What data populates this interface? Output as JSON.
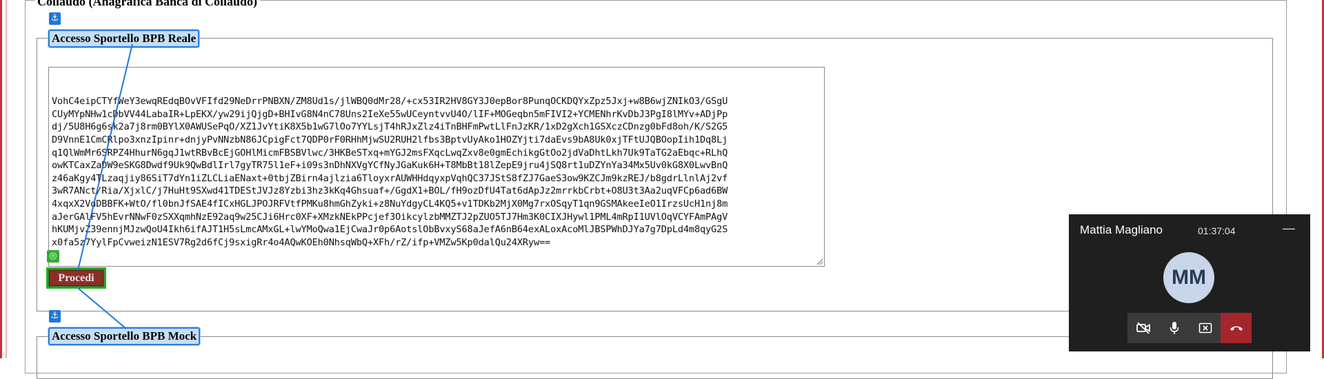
{
  "page": {
    "outer_legend": "Collaudo (Anagrafica Banca di Collaudo)",
    "section_real": {
      "legend": "Accesso Sportello BPB Reale"
    },
    "section_mock": {
      "legend": "Accesso Sportello BPB Mock"
    }
  },
  "token_lines": [
    "VohC4eipCTYfWeY3ewqREdqBOvVFIfd29NeDrrPNBXN/ZM8Ud1s/jlWBQ0dMr28/+cx53IR2HV8GY3J0epBor8PunqOCKDQYxZpz5Jxj+w8B6wjZNIkO3/GSgU",
    "CUyMYpNHw1cDbVV44LabaIR+LpEKX/yw29ijQjgD+BHIvG8N4nC78Uns2IeXe55wUCeyntvvU4O/lIF+MOGeqbn5mFIVI2+YCMENhrKvDbJ3PgI8lMYv+ADjPp",
    "dj/5U8H6g6sk2a7j8rm0BYlX0AWUSePqO/XZ1JvYtiK8X5b1wG7lOo7YYLsjT4hRJxZlz4iTnBHFmPwtLlFnJzKR/1xD2gXch1GSXczCDnzg0bFd8oh/K/S2G5",
    "D9VnnE1CmCRlpo3xnzIpinr+dnjyPvNNzbN86JCpigFct7QDP0rF0RHhMjwSU2RUH2lfbs3BptvUyAko1HOZYjti7daEvs9bA8Uk0xjTFtUJQBOopIih1Dq8Lj",
    "q1QlWmMr6SRPZ4HhurN6gqJ1wtRBvBcEjGOHlMicmFBSBVlwc/3HKBeSTxq+mYGJ2msFXqcLwqZxv8e0gmEchikgGtOo2jdVaDhtLkh7Uk9TaTG2aEbqc+RLhQ",
    "owKTCaxZaDW9eSKG8Dwdf9Uk9QwBdlIrl7gyTR75l1eF+i09s3nDhNXVgYCfNyJGaKuk6H+T8MbBt18lZepE9jru4jSQ8rt1uDZYnYa34Mx5Uv0kG8X0LwvBnQ",
    "z46aKgy4TLzaqjiy86SiT7dYn1iZLCLiaENaxt+0tbjZBirn4ajlzia6TloyxrAUWHHdqyxpVqhQC37JStS8fZJ7GaeS3ow9KZCJm9kzREJ/b8gdrLlnlAj2vf",
    "3wR7ANct/Ria/XjxlC/j7HuHt9SXwd41TDEStJVJz8Yzbi3hz3kKq4Ghsuaf+/GgdX1+BOL/fH9ozDfU4Tat6dApJz2mrrkbCrbt+O8U3t3Aa2uqVFCp6ad6BW",
    "4xqxX2VdDBBFK+WtO/fl0bnJfSAE4fICxHGLJPOJRFVtfPMKu8hmGhZyki+z8NuYdgyCL4KQ5+v1TDKb2MjX0Mg7rxOSqyT1qn9GSMAkeeIeO1IrzsUcH1nj8m",
    "aJerGAlFV5hEvrNNwF0zSXXqmhNzE92aq9w25CJi6Hrc0XF+XMzkNEkPPcjef3OikcylzbMMZTJ2pZUO5TJ7Hm3K0CIXJHywl1PML4mRpI1UVlOqVCYFAmPAgV",
    "hKUMjvZ39ennjMJzwQoU4Ikh6ifAJT1H5sLmcAMxGL+lwYMoQwa1EjCwaJr0p6AotslObBvxyS68aJefA6nB64exALoxAcoMlJBSPWhDJYa7g7DpLd4m8qyG2S",
    "x0fa5z7YylFpCvweizN1ESV7Rg2d6fCj9sxigRr4o4AQwKOEh0NhsqWbQ+XFh/rZ/ifp+VMZw5Kp0dalQu24XRyw=="
  ],
  "proceed_button": {
    "label": "Procedi"
  },
  "call": {
    "caller_name": "Mattia Magliano",
    "duration": "01:37:04",
    "initials": "MM",
    "minimize_symbol": "—",
    "colors": {
      "panel_bg": "#1f1f1f",
      "end_call": "#a4262c",
      "avatar_bg": "#c9d5e8"
    }
  },
  "icons": {
    "anchor": "⚓",
    "target": "◎"
  }
}
